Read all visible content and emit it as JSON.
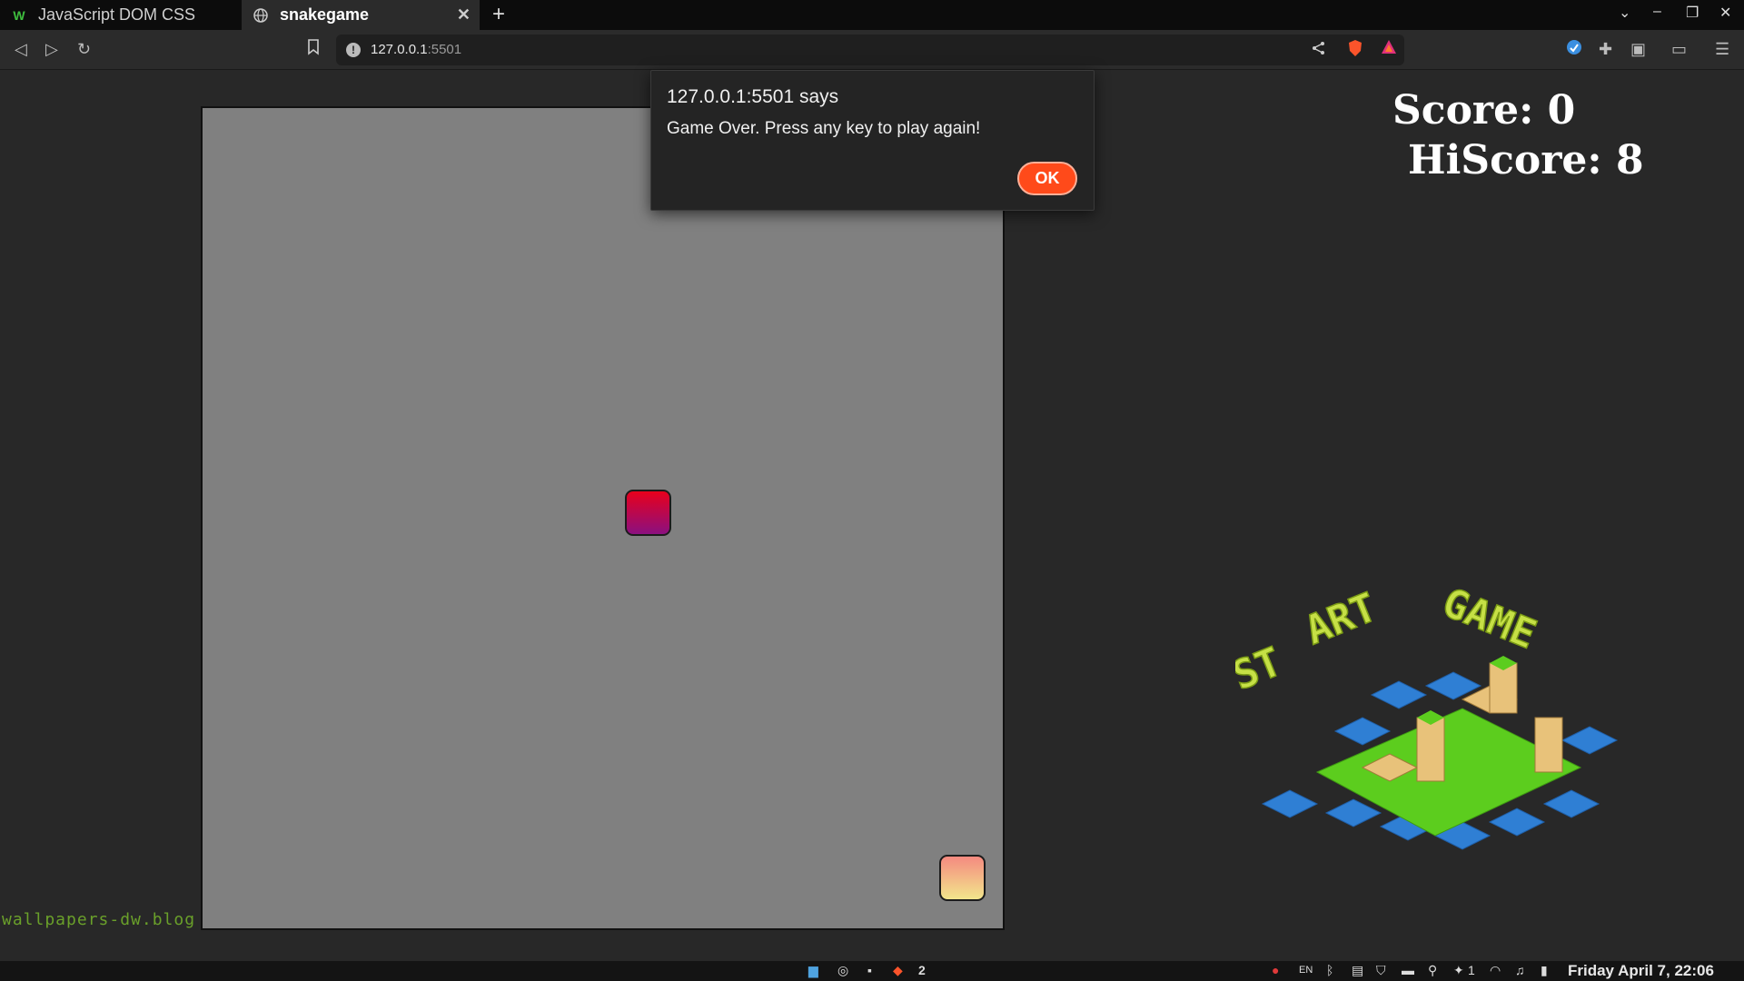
{
  "tabs": [
    {
      "label": "JavaScript DOM CSS",
      "icon": "w-favicon-icon"
    },
    {
      "label": "snakegame",
      "icon": "globe-icon"
    }
  ],
  "address": {
    "host": "127.0.0.1",
    "port": ":5501"
  },
  "game": {
    "score_label": "Score: 0",
    "hiscore_label": "HiScore: 8",
    "watermark": "wallpapers-dw.blog"
  },
  "dialog": {
    "title": "127.0.0.1:5501 says",
    "message": "Game Over. Press any key to play again!",
    "ok_label": "OK"
  },
  "taskbar": {
    "workspace": "2",
    "lang": "EN",
    "notif_count": "1",
    "clock": "Friday April  7, 22:06"
  },
  "colors": {
    "accent": "#ff4a1a",
    "food": "#e8001c",
    "snake": "#f2b080",
    "board": "#808080"
  }
}
